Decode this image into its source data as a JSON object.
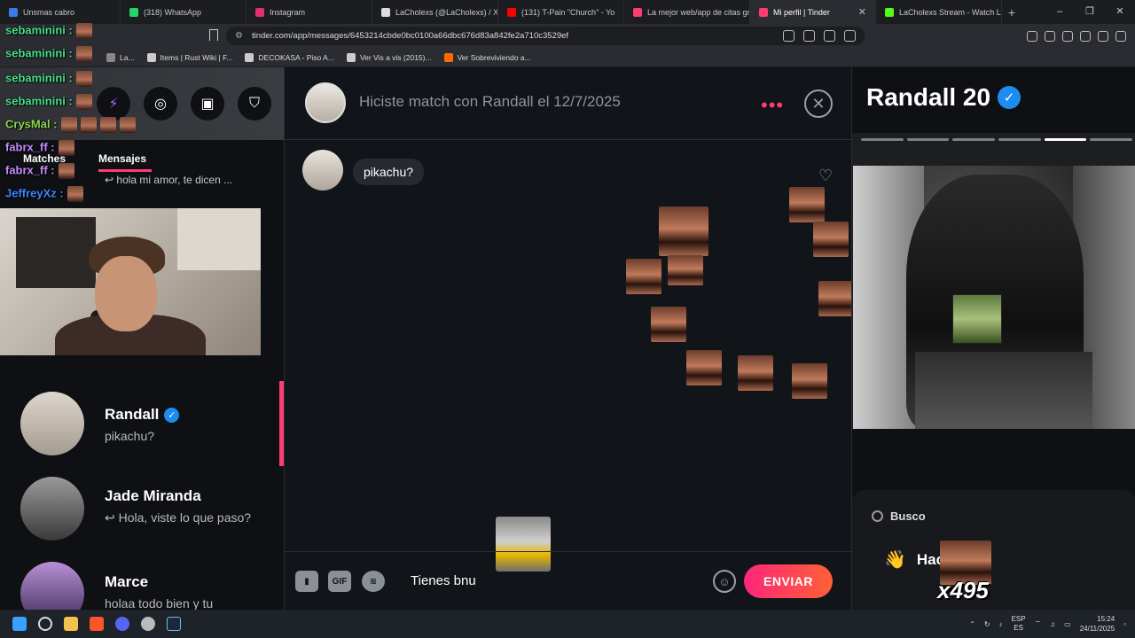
{
  "browser": {
    "tabs": [
      {
        "label": "Unsmas cabro",
        "color": "#3a7be8"
      },
      {
        "label": "(318) WhatsApp",
        "color": "#25d366"
      },
      {
        "label": "Instagram",
        "color": "#e1306c"
      },
      {
        "label": "LaCholexs (@LaCholexs) / X",
        "color": "#dddddd"
      },
      {
        "label": "(131) T-Pain \"Church\" - Yo",
        "color": "#ff0000"
      },
      {
        "label": "La mejor web/app de citas gra",
        "color": "#fe3c72"
      },
      {
        "label": "Mi perfil | Tinder",
        "color": "#fe3c72"
      },
      {
        "label": "LaCholexs Stream - Watch Live",
        "color": "#53fc18"
      }
    ],
    "active_tab_index": 6,
    "new_tab": "+",
    "window_controls": [
      "–",
      "❐",
      "✕"
    ],
    "url": "tinder.com/app/messages/6453214cbde0bc0100a66dbc676d83a842fe2a710c3529ef",
    "bookmarks": [
      {
        "label": "La...",
        "color": "#888888"
      },
      {
        "label": "Items | Rust Wiki | F...",
        "color": "#cccccc"
      },
      {
        "label": "DECOKASA - Piso A...",
        "color": "#cccccc"
      },
      {
        "label": "Ver Vis a vis (2015)...",
        "color": "#cccccc"
      },
      {
        "label": "Ver Sobreviviendo a...",
        "color": "#ff6a00"
      }
    ]
  },
  "left_panel": {
    "header_icons": [
      "lightning-icon",
      "compass-icon",
      "briefcase-icon",
      "shield-icon"
    ],
    "tab_matches": "Matches",
    "tab_messages": "Mensajes",
    "top_snippet": "↩ hola mi amor, te dicen ...",
    "stream_chat": [
      {
        "user": "sebaminini :",
        "color": "#47e08a"
      },
      {
        "user": "sebaminini :",
        "color": "#47e08a"
      },
      {
        "user": "sebaminini :",
        "color": "#47e08a"
      },
      {
        "user": "sebaminini :",
        "color": "#47e08a"
      },
      {
        "user": "CrysMal :",
        "color": "#8ad94f"
      },
      {
        "user": "fabrx_ff :",
        "color": "#c58cff"
      },
      {
        "user": "fabrx_ff :",
        "color": "#c58cff"
      },
      {
        "user": "JeffreyXz :",
        "color": "#3e84ff"
      }
    ],
    "conversations": [
      {
        "name": "Randall",
        "verified": true,
        "snippet": "pikachu?",
        "active": true
      },
      {
        "name": "Jade Miranda",
        "verified": false,
        "snippet": "↩ Hola, viste lo que paso?",
        "active": false
      },
      {
        "name": "Marce",
        "verified": false,
        "snippet": "holaa todo bien y tu",
        "active": false
      }
    ]
  },
  "chat": {
    "header_title": "Hiciste match con Randall el 12/7/2025",
    "more_label": "•••",
    "close_label": "✕",
    "messages": [
      {
        "text": "pikachu?"
      }
    ],
    "composer": {
      "gif_label": "GIF",
      "input_value": "Tienes bnu",
      "send_label": "ENVIAR"
    }
  },
  "profile": {
    "name": "Randall 20",
    "verified": true,
    "photo_count": 6,
    "active_photo_index": 4,
    "busco_label": "Busco",
    "busco_value": "Hac...gxs",
    "overlay_counter": "x495"
  },
  "taskbar": {
    "language": "ESP",
    "language_sub": "ES",
    "time": "15:24",
    "date": "24/11/2025"
  }
}
